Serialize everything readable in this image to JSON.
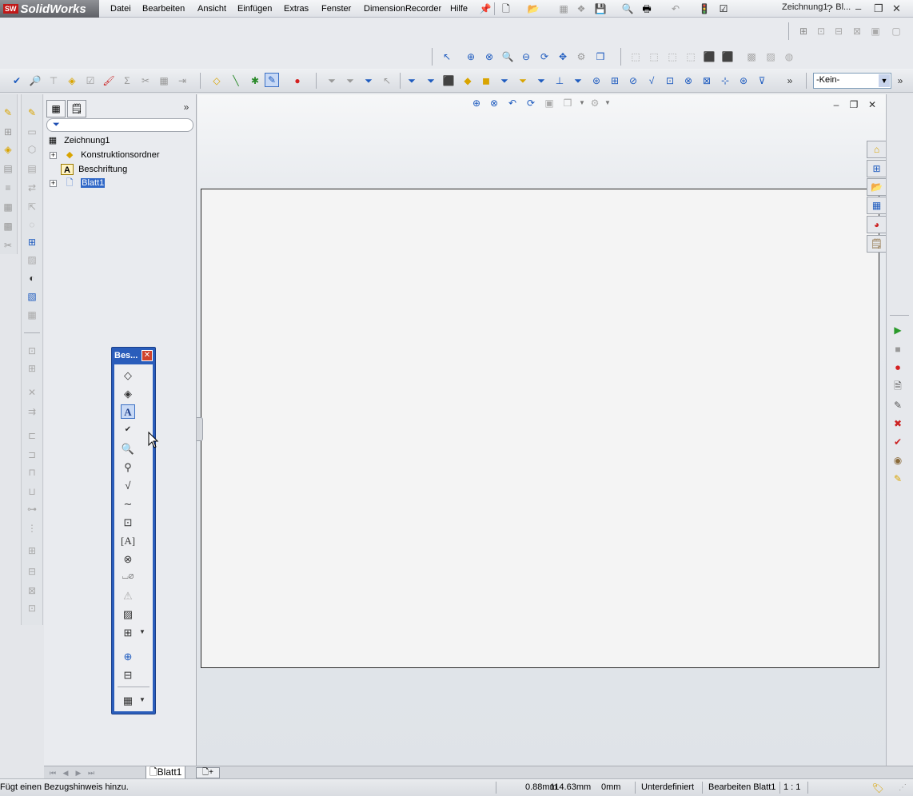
{
  "app": {
    "logo_brand": "SolidWorks",
    "logo_badge": "SW",
    "document_title": "Zeichnung1 - Bl...",
    "help_symbol": "?"
  },
  "menu": {
    "items": [
      "Datei",
      "Bearbeiten",
      "Ansicht",
      "Einfügen",
      "Extras",
      "Fenster",
      "DimensionRecorder",
      "Hilfe"
    ]
  },
  "toolbar": {
    "selection_filter_value": "-Kein-"
  },
  "feature_manager": {
    "tree": [
      {
        "label": "Zeichnung1",
        "icon": "drawing-icon",
        "expander": false,
        "indent": 0
      },
      {
        "label": "Konstruktionsordner",
        "icon": "design-folder-icon",
        "expander": true,
        "indent": 1
      },
      {
        "label": "Beschriftung",
        "icon": "annotation-icon",
        "expander": false,
        "indent": 1
      },
      {
        "label": "Blatt1",
        "icon": "sheet-icon",
        "expander": true,
        "indent": 1,
        "selected": true
      }
    ]
  },
  "palette": {
    "title": "Bes...",
    "close_symbol": "✕"
  },
  "sheet_tabs": {
    "active": "Blatt1"
  },
  "status": {
    "message": "Fügt einen Bezugshinweis hinzu.",
    "x": "0.88mm",
    "y": "114.63mm",
    "z": "0mm",
    "definition": "Unterdefiniert",
    "edit_state": "Bearbeiten Blatt1",
    "scale": "1 : 1"
  },
  "colors": {
    "accent_selection": "#2f67c7",
    "palette_frame": "#2a5dbb",
    "logo_red": "#c01818"
  }
}
